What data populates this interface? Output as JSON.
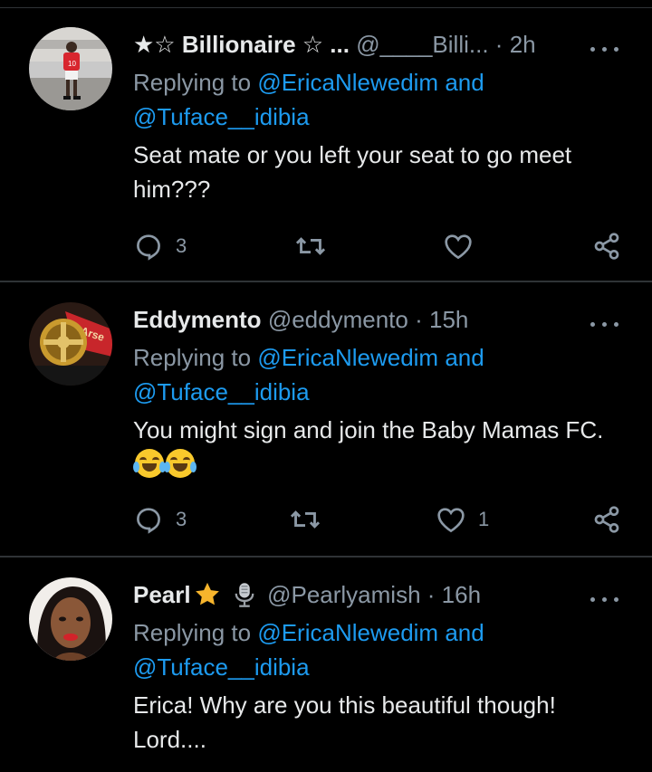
{
  "tweets": [
    {
      "name": "★☆ Billionaire ☆ ...",
      "handle": "@____Billi...",
      "dot": "·",
      "time": "2h",
      "replying_prefix": "Replying to",
      "mention1": "@EricaNlewedim",
      "and": "and",
      "mention2": "@Tuface__idibia",
      "text": "Seat mate or you left your seat to go meet him???",
      "replies": "3",
      "retweets": "",
      "likes": ""
    },
    {
      "name": "Eddymento",
      "handle": "@eddymento",
      "dot": "·",
      "time": "15h",
      "replying_prefix": "Replying to",
      "mention1": "@EricaNlewedim",
      "and": "and",
      "mention2": "@Tuface__idibia",
      "text": "You might sign and join the Baby Mamas FC.",
      "replies": "3",
      "retweets": "",
      "likes": "1"
    },
    {
      "name": "Pearl",
      "handle": "@Pearlyamish",
      "dot": "·",
      "time": "16h",
      "replying_prefix": "Replying to",
      "mention1": "@EricaNlewedim",
      "and": "and",
      "mention2": "@Tuface__idibia",
      "text": "Erica! Why are you this beautiful though! Lord....",
      "replies": "",
      "retweets": "",
      "likes": ""
    }
  ],
  "icons": {
    "reply": "reply-icon",
    "retweet": "retweet-icon",
    "like": "heart-icon",
    "share": "share-icon",
    "more": "more-icon",
    "emoji": "tears-of-joy-emoji",
    "star": "star-emoji",
    "mic": "microphone-emoji"
  },
  "colors": {
    "background": "#000000",
    "text": "#e7e9ea",
    "secondary": "#8b98a5",
    "link": "#1d9bf0",
    "divider": "#2f3336"
  }
}
